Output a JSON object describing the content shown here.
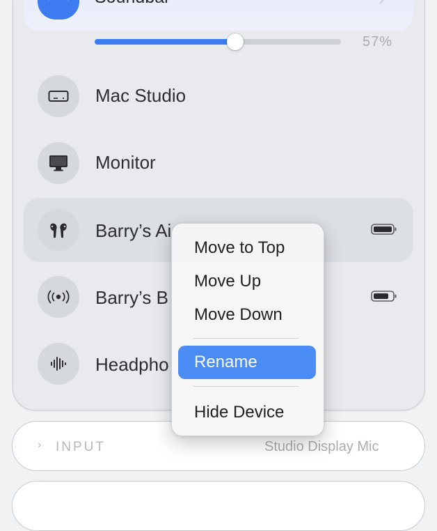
{
  "output_devices": {
    "selected": {
      "name": "Soundbar",
      "volume_percent": 57,
      "volume_label": "57%"
    },
    "items": [
      {
        "name": "Mac Studio"
      },
      {
        "name": "Monitor"
      },
      {
        "name": "Barry’s Ai"
      },
      {
        "name": "Barry’s B"
      },
      {
        "name": "Headpho"
      }
    ]
  },
  "context_menu": {
    "move_to_top": "Move to Top",
    "move_up": "Move Up",
    "move_down": "Move Down",
    "rename": "Rename",
    "hide_device": "Hide Device"
  },
  "input_section": {
    "label": "INPUT",
    "value": "Studio Display Mic"
  },
  "colors": {
    "accent": "#3c7bf0",
    "menu_highlight": "#4a8cf3"
  }
}
